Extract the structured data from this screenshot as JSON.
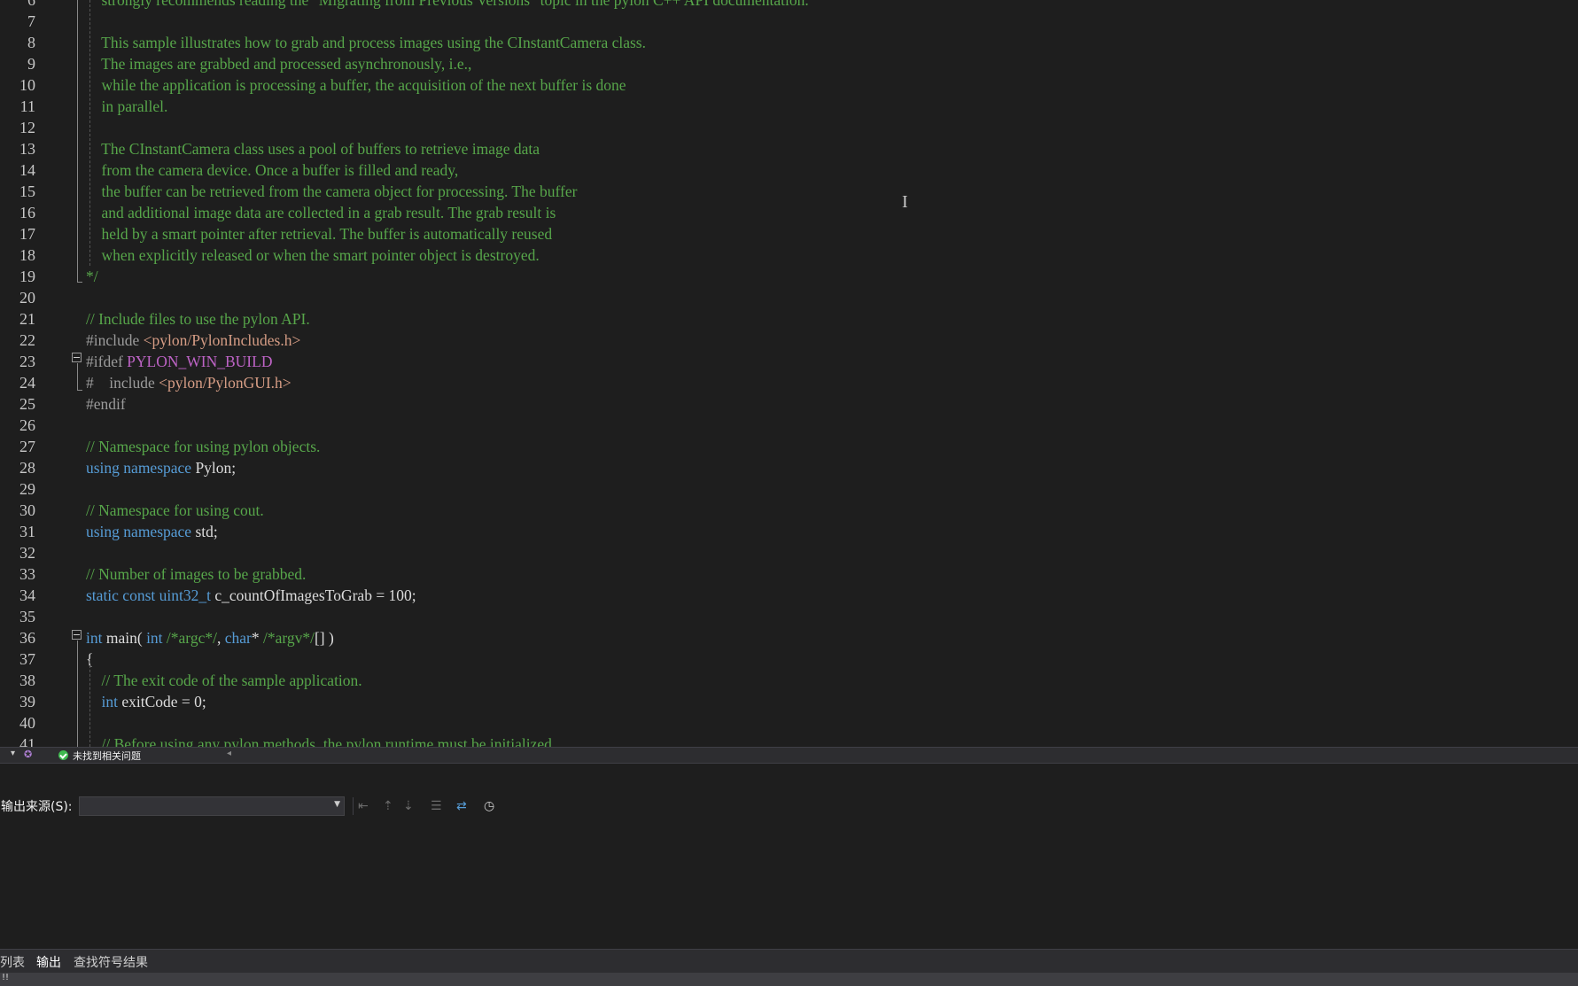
{
  "editor": {
    "lines": [
      {
        "n": "6",
        "parts": [
          {
            "t": "    strongly recommends reading the \"Migrating from Previous Versions\" topic in the pylon C++ API documentation.",
            "c": "comment"
          }
        ]
      },
      {
        "n": "7",
        "parts": []
      },
      {
        "n": "8",
        "parts": [
          {
            "t": "    This sample illustrates how to grab and process images using the CInstantCamera class.",
            "c": "comment"
          }
        ]
      },
      {
        "n": "9",
        "parts": [
          {
            "t": "    The images are grabbed and processed asynchronously, i.e.,",
            "c": "comment"
          }
        ]
      },
      {
        "n": "10",
        "parts": [
          {
            "t": "    while the application is processing a buffer, the acquisition of the next buffer is done",
            "c": "comment"
          }
        ]
      },
      {
        "n": "11",
        "parts": [
          {
            "t": "    in parallel.",
            "c": "comment"
          }
        ]
      },
      {
        "n": "12",
        "parts": []
      },
      {
        "n": "13",
        "parts": [
          {
            "t": "    The CInstantCamera class uses a pool of buffers to retrieve image data",
            "c": "comment"
          }
        ]
      },
      {
        "n": "14",
        "parts": [
          {
            "t": "    from the camera device. Once a buffer is filled and ready,",
            "c": "comment"
          }
        ]
      },
      {
        "n": "15",
        "parts": [
          {
            "t": "    the buffer can be retrieved from the camera object for processing. The buffer",
            "c": "comment"
          }
        ]
      },
      {
        "n": "16",
        "parts": [
          {
            "t": "    and additional image data are collected in a grab result. The grab result is",
            "c": "comment"
          }
        ]
      },
      {
        "n": "17",
        "parts": [
          {
            "t": "    held by a smart pointer after retrieval. The buffer is automatically reused",
            "c": "comment"
          }
        ]
      },
      {
        "n": "18",
        "parts": [
          {
            "t": "    when explicitly released or when the smart pointer object is destroyed.",
            "c": "comment"
          }
        ]
      },
      {
        "n": "19",
        "parts": [
          {
            "t": "*/",
            "c": "comment"
          }
        ]
      },
      {
        "n": "20",
        "parts": []
      },
      {
        "n": "21",
        "parts": [
          {
            "t": "// Include files to use the pylon API.",
            "c": "comment"
          }
        ]
      },
      {
        "n": "22",
        "parts": [
          {
            "t": "#include ",
            "c": "pre"
          },
          {
            "t": "<pylon/PylonIncludes.h>",
            "c": "str"
          }
        ]
      },
      {
        "n": "23",
        "parts": [
          {
            "t": "#ifdef ",
            "c": "pre"
          },
          {
            "t": "PYLON_WIN_BUILD",
            "c": "macro"
          }
        ]
      },
      {
        "n": "24",
        "parts": [
          {
            "t": "#    include ",
            "c": "pre"
          },
          {
            "t": "<pylon/PylonGUI.h>",
            "c": "str"
          }
        ]
      },
      {
        "n": "25",
        "parts": [
          {
            "t": "#endif",
            "c": "pre"
          }
        ]
      },
      {
        "n": "26",
        "parts": []
      },
      {
        "n": "27",
        "parts": [
          {
            "t": "// Namespace for using pylon objects.",
            "c": "comment"
          }
        ]
      },
      {
        "n": "28",
        "parts": [
          {
            "t": "using namespace ",
            "c": "kw"
          },
          {
            "t": "Pylon;",
            "c": "ns"
          }
        ]
      },
      {
        "n": "29",
        "parts": []
      },
      {
        "n": "30",
        "parts": [
          {
            "t": "// Namespace for using cout.",
            "c": "comment"
          }
        ]
      },
      {
        "n": "31",
        "parts": [
          {
            "t": "using namespace ",
            "c": "kw"
          },
          {
            "t": "std;",
            "c": "ns"
          }
        ]
      },
      {
        "n": "32",
        "parts": []
      },
      {
        "n": "33",
        "parts": [
          {
            "t": "// Number of images to be grabbed.",
            "c": "comment"
          }
        ]
      },
      {
        "n": "34",
        "parts": [
          {
            "t": "static const uint32_t ",
            "c": "kw"
          },
          {
            "t": "c_countOfImagesToGrab = 100;",
            "c": "ns"
          }
        ]
      },
      {
        "n": "35",
        "parts": []
      },
      {
        "n": "36",
        "parts": [
          {
            "t": "int ",
            "c": "kw"
          },
          {
            "t": "main( ",
            "c": "ns"
          },
          {
            "t": "int ",
            "c": "kw"
          },
          {
            "t": "/*argc*/",
            "c": "comment"
          },
          {
            "t": ", ",
            "c": "ns"
          },
          {
            "t": "char",
            "c": "kw"
          },
          {
            "t": "* ",
            "c": "ns"
          },
          {
            "t": "/*argv*/",
            "c": "comment"
          },
          {
            "t": "[] )",
            "c": "ns"
          }
        ]
      },
      {
        "n": "37",
        "parts": [
          {
            "t": "{",
            "c": "ns"
          }
        ]
      },
      {
        "n": "38",
        "parts": [
          {
            "t": "    // The exit code of the sample application.",
            "c": "comment"
          }
        ]
      },
      {
        "n": "39",
        "parts": [
          {
            "t": "    int ",
            "c": "kw"
          },
          {
            "t": "exitCode = 0;",
            "c": "ns"
          }
        ]
      },
      {
        "n": "40",
        "parts": []
      },
      {
        "n": "41",
        "parts": [
          {
            "t": "    // Before using any pylon methods, the pylon runtime must be initialized.",
            "c": "comment"
          }
        ]
      }
    ]
  },
  "status": {
    "dropdown_icon": "chevron-down-icon",
    "assistant_icon": "copilot-icon",
    "issues_icon": "check-circle-icon",
    "issues_text": "未找到相关问题",
    "scroll_icon": "caret-left-icon"
  },
  "output_panel": {
    "source_label": "输出来源(S):",
    "source_value": "",
    "icons": [
      "find-in-output-icon",
      "go-previous-icon",
      "go-next-icon",
      "clear-all-icon",
      "word-wrap-icon",
      "timestamp-clock-icon"
    ]
  },
  "tabs": [
    {
      "label": "列表",
      "active": false
    },
    {
      "label": "输出",
      "active": true
    },
    {
      "label": "查找符号结果",
      "active": false
    }
  ],
  "bottom_bar": {
    "text": "!!"
  }
}
